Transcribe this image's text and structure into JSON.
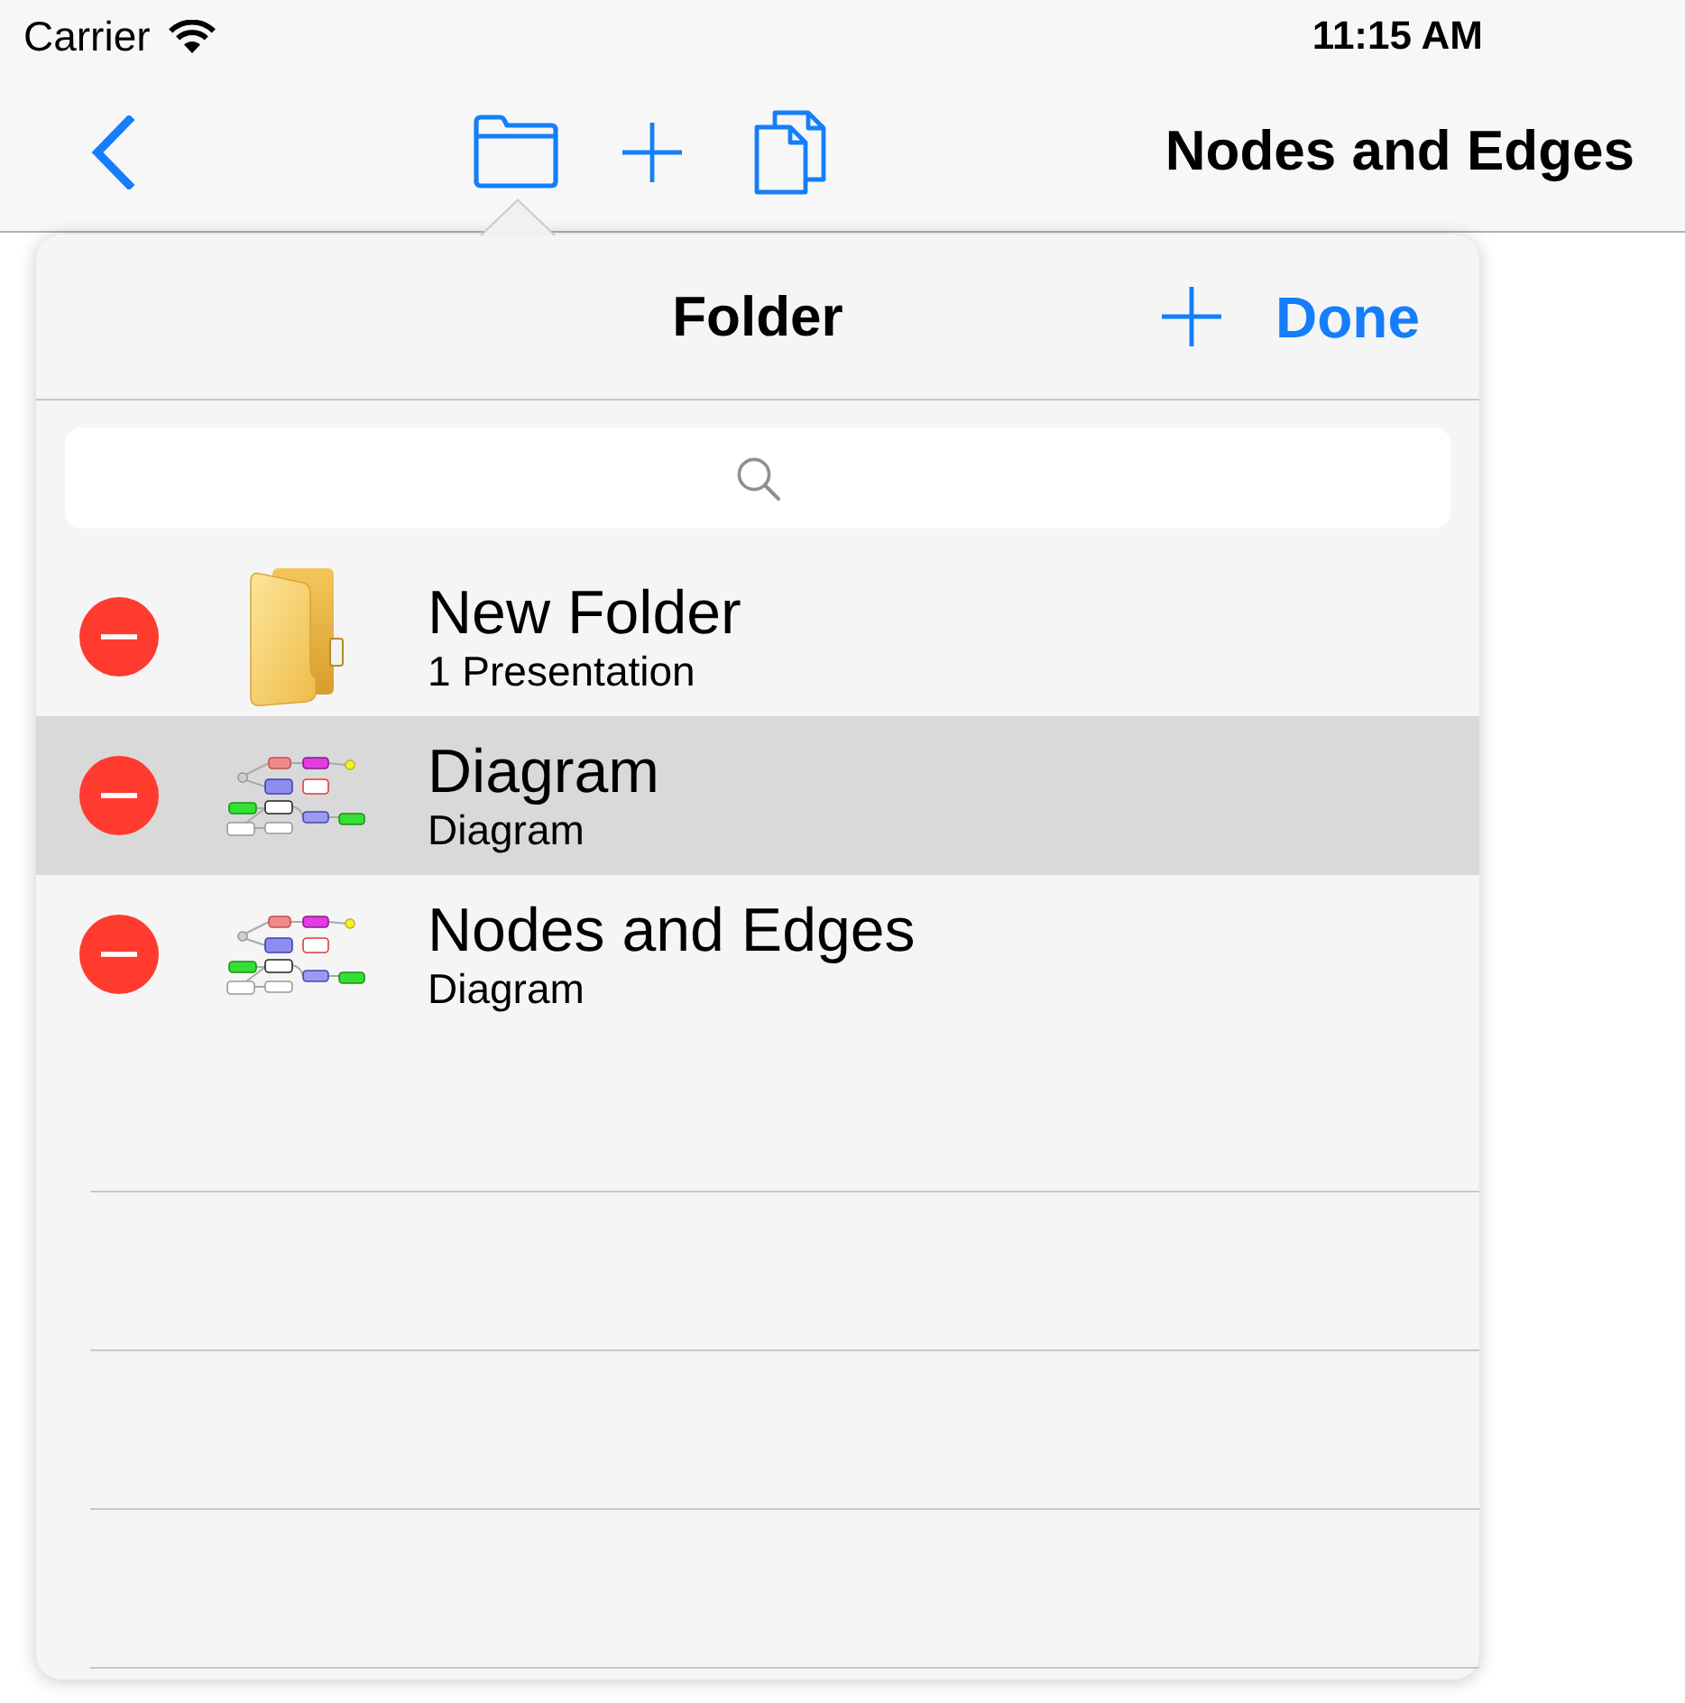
{
  "status_bar": {
    "carrier": "Carrier",
    "time": "11:15 AM"
  },
  "nav_bar": {
    "title": "Nodes and Edges"
  },
  "popover": {
    "title": "Folder",
    "done_button": "Done",
    "items": [
      {
        "kind": "folder",
        "title": "New Folder",
        "subtitle": "1 Presentation",
        "selected": false
      },
      {
        "kind": "diagram",
        "title": "Diagram",
        "subtitle": "Diagram",
        "selected": true
      },
      {
        "kind": "diagram",
        "title": "Nodes and Edges",
        "subtitle": "Diagram",
        "selected": false
      }
    ]
  }
}
